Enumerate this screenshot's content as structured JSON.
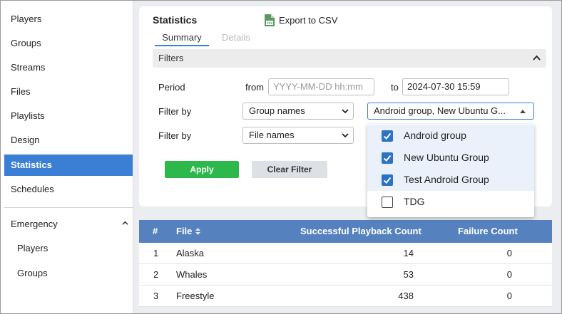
{
  "sidebar": {
    "items": [
      {
        "label": "Players"
      },
      {
        "label": "Groups"
      },
      {
        "label": "Streams"
      },
      {
        "label": "Files"
      },
      {
        "label": "Playlists"
      },
      {
        "label": "Design"
      },
      {
        "label": "Statistics",
        "active": true
      },
      {
        "label": "Schedules"
      }
    ],
    "group": {
      "label": "Emergency",
      "expanded": true
    },
    "subitems": [
      {
        "label": "Players"
      },
      {
        "label": "Groups"
      }
    ]
  },
  "header": {
    "title": "Statistics",
    "export_label": "Export to CSV"
  },
  "tabs": [
    {
      "label": "Summary",
      "active": true
    },
    {
      "label": "Details",
      "active": false
    }
  ],
  "filters": {
    "section_label": "Filters",
    "period_label": "Period",
    "from_label": "from",
    "from_placeholder": "YYYY-MM-DD hh:mm",
    "to_label": "to",
    "to_value": "2024-07-30 15:59",
    "filter_by_label": "Filter by",
    "filter1_select": "Group names",
    "filter1_value": "Android group, New Ubuntu G...",
    "filter2_select": "File names",
    "apply_label": "Apply",
    "clear_label": "Clear Filter"
  },
  "dropdown_options": [
    {
      "label": "Android group",
      "checked": true
    },
    {
      "label": "New Ubuntu Group",
      "checked": true
    },
    {
      "label": "Test Android Group",
      "checked": true
    },
    {
      "label": "TDG",
      "checked": false
    }
  ],
  "table": {
    "headers": [
      "#",
      "File",
      "Successful Playback Count",
      "Failure Count"
    ],
    "rows": [
      {
        "num": "1",
        "file": "Alaska",
        "success": "14",
        "failure": "0"
      },
      {
        "num": "2",
        "file": "Whales",
        "success": "53",
        "failure": "0"
      },
      {
        "num": "3",
        "file": "Freestyle",
        "success": "438",
        "failure": "0"
      }
    ]
  },
  "colors": {
    "accent": "#3b7fd4",
    "apply": "#2db84b",
    "table_header": "#5582bf",
    "checkbox": "#2a73c8"
  }
}
